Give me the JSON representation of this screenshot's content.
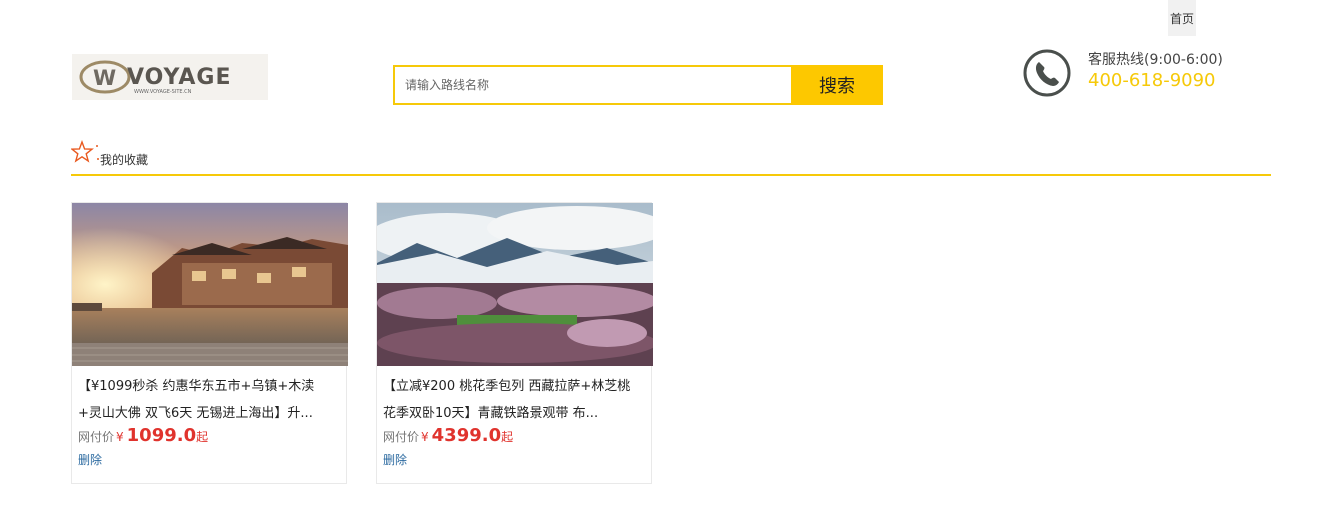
{
  "topnav": {
    "home_label": "首页"
  },
  "logo": {
    "wordmark": "VOYAGE",
    "site_url": "WWW.VOYAGE-SITE.CN",
    "monogram": "W"
  },
  "search": {
    "placeholder": "请输入路线名称",
    "value": "",
    "button_label": "搜索"
  },
  "hotline": {
    "label": "客服热线(9:00-6:00)",
    "number": "400-618-9090",
    "icon": "phone-icon"
  },
  "favorites": {
    "title": "我的收藏",
    "icon": "star-icon"
  },
  "cards": [
    {
      "title": "【¥1099秒杀 约惠华东五市+乌镇+木渎+灵山大佛 双飞6天 无锡进上海出】升...",
      "price_label": "网付价",
      "currency": "¥",
      "price": "1099.0",
      "unit": "起",
      "delete_label": "删除",
      "image": "water-town-photo"
    },
    {
      "title": "【立减¥200 桃花季包列 西藏拉萨+林芝桃花季双卧10天】青藏铁路景观带 布...",
      "price_label": "网付价",
      "currency": "¥",
      "price": "4399.0",
      "unit": "起",
      "delete_label": "删除",
      "image": "peach-blossom-mountain-photo"
    }
  ],
  "colors": {
    "accent": "#f6c909",
    "button": "#fdc800",
    "price": "#e0332d",
    "link": "#2c6aa0"
  }
}
